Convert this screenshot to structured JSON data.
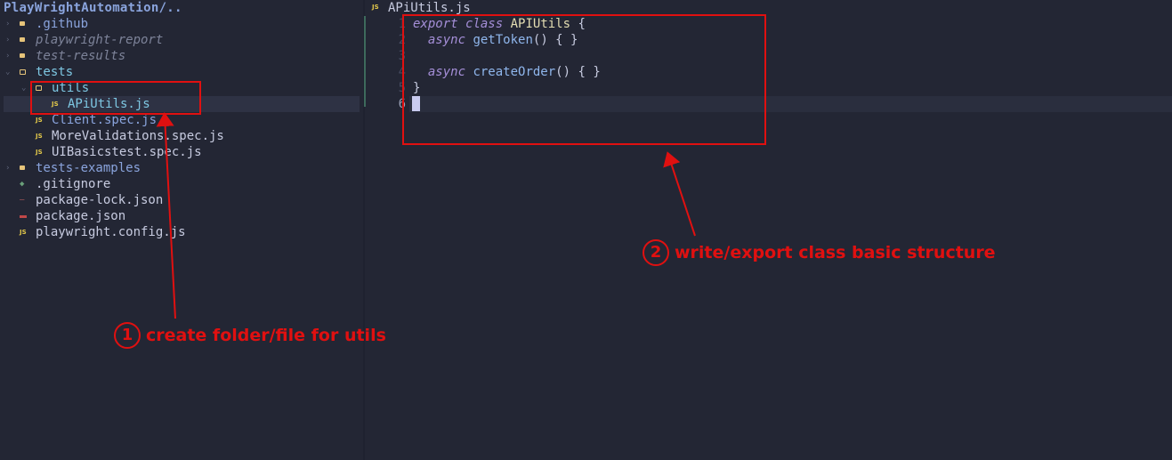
{
  "sidebar": {
    "project_title": "PlayWrightAutomation/..",
    "items": [
      {
        "label": ".github",
        "kind": "folder",
        "style": "dir"
      },
      {
        "label": "playwright-report",
        "kind": "folder",
        "style": "italic"
      },
      {
        "label": "test-results",
        "kind": "folder",
        "style": "italic"
      },
      {
        "label": "tests",
        "kind": "folder-open",
        "style": "teal"
      },
      {
        "label": "utils",
        "kind": "folder-open",
        "style": "teal"
      },
      {
        "label": "APiUtils.js",
        "kind": "js",
        "style": "teal",
        "selected": true
      },
      {
        "label": "Client.spec.js",
        "kind": "js",
        "style": "dir"
      },
      {
        "label": "MoreValidations.spec.js",
        "kind": "js",
        "style": "plain"
      },
      {
        "label": "UIBasicstest.spec.js",
        "kind": "js",
        "style": "plain"
      },
      {
        "label": "tests-examples",
        "kind": "folder",
        "style": "dir"
      },
      {
        "label": ".gitignore",
        "kind": "git",
        "style": "plain"
      },
      {
        "label": "package-lock.json",
        "kind": "lock",
        "style": "plain"
      },
      {
        "label": "package.json",
        "kind": "package",
        "style": "plain"
      },
      {
        "label": "playwright.config.js",
        "kind": "js",
        "style": "plain"
      }
    ],
    "js_badge": "JS"
  },
  "editor": {
    "tab_title": "APiUtils.js",
    "js_badge": "JS",
    "line_numbers": [
      "1",
      "2",
      "3",
      "4",
      "5",
      "6"
    ],
    "code": {
      "l1_kw1": "export",
      "l1_kw2": "class",
      "l1_name": "APIUtils",
      "l1_rest": " {",
      "l2_kw": "async",
      "l2_fn": "getToken",
      "l2_rest": "() { }",
      "l4_kw": "async",
      "l4_fn": "createOrder",
      "l4_rest": "() { }",
      "l5": "}"
    }
  },
  "annotations": {
    "note1_number": "1",
    "note1_text": "create folder/file for utils",
    "note2_number": "2",
    "note2_text": "write/export class basic structure",
    "color": "#e01010"
  },
  "colors": {
    "background": "#232634",
    "folder_icon": "#e6c47a",
    "js_icon": "#e2c84a",
    "annotation_red": "#e01010"
  }
}
